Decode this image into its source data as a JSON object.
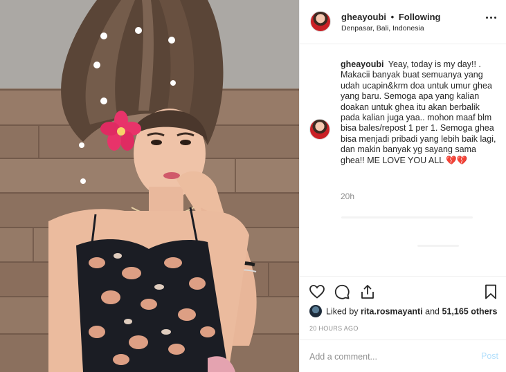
{
  "post": {
    "username": "gheayoubi",
    "separator": "•",
    "follow_status": "Following",
    "location": "Denpasar, Bali, Indonesia",
    "caption_text": "Yeay, today is my day!! . Makacii banyak buat semuanya yang udah ucapin&krm doa untuk umur ghea yang baru. Semoga apa yang kalian doakan untuk ghea itu akan berbalik pada kalian juga yaa.. mohon maaf blm bisa bales/repost 1 per 1. Semoga ghea bisa menjadi pribadi yang lebih baik lagi, dan makin banyak yg sayang sama ghea!! ME LOVE YOU ALL",
    "caption_emoji": "💔💔",
    "caption_age": "20h"
  },
  "likes": {
    "prefix": "Liked by",
    "liker": "rita.rosmayanti",
    "connector": "and",
    "others": "51,165 others"
  },
  "timestamp": "20 HOURS AGO",
  "comment": {
    "placeholder": "Add a comment...",
    "post_label": "Post"
  },
  "icons": {
    "more": "more-options-icon",
    "like": "heart-icon",
    "comment": "comment-icon",
    "share": "share-icon",
    "save": "bookmark-icon"
  },
  "colors": {
    "text": "#262626",
    "muted": "#8e8e8e",
    "post_button": "#b2dffc",
    "heart_emoji": "#d3323b",
    "divider": "#efefef"
  }
}
